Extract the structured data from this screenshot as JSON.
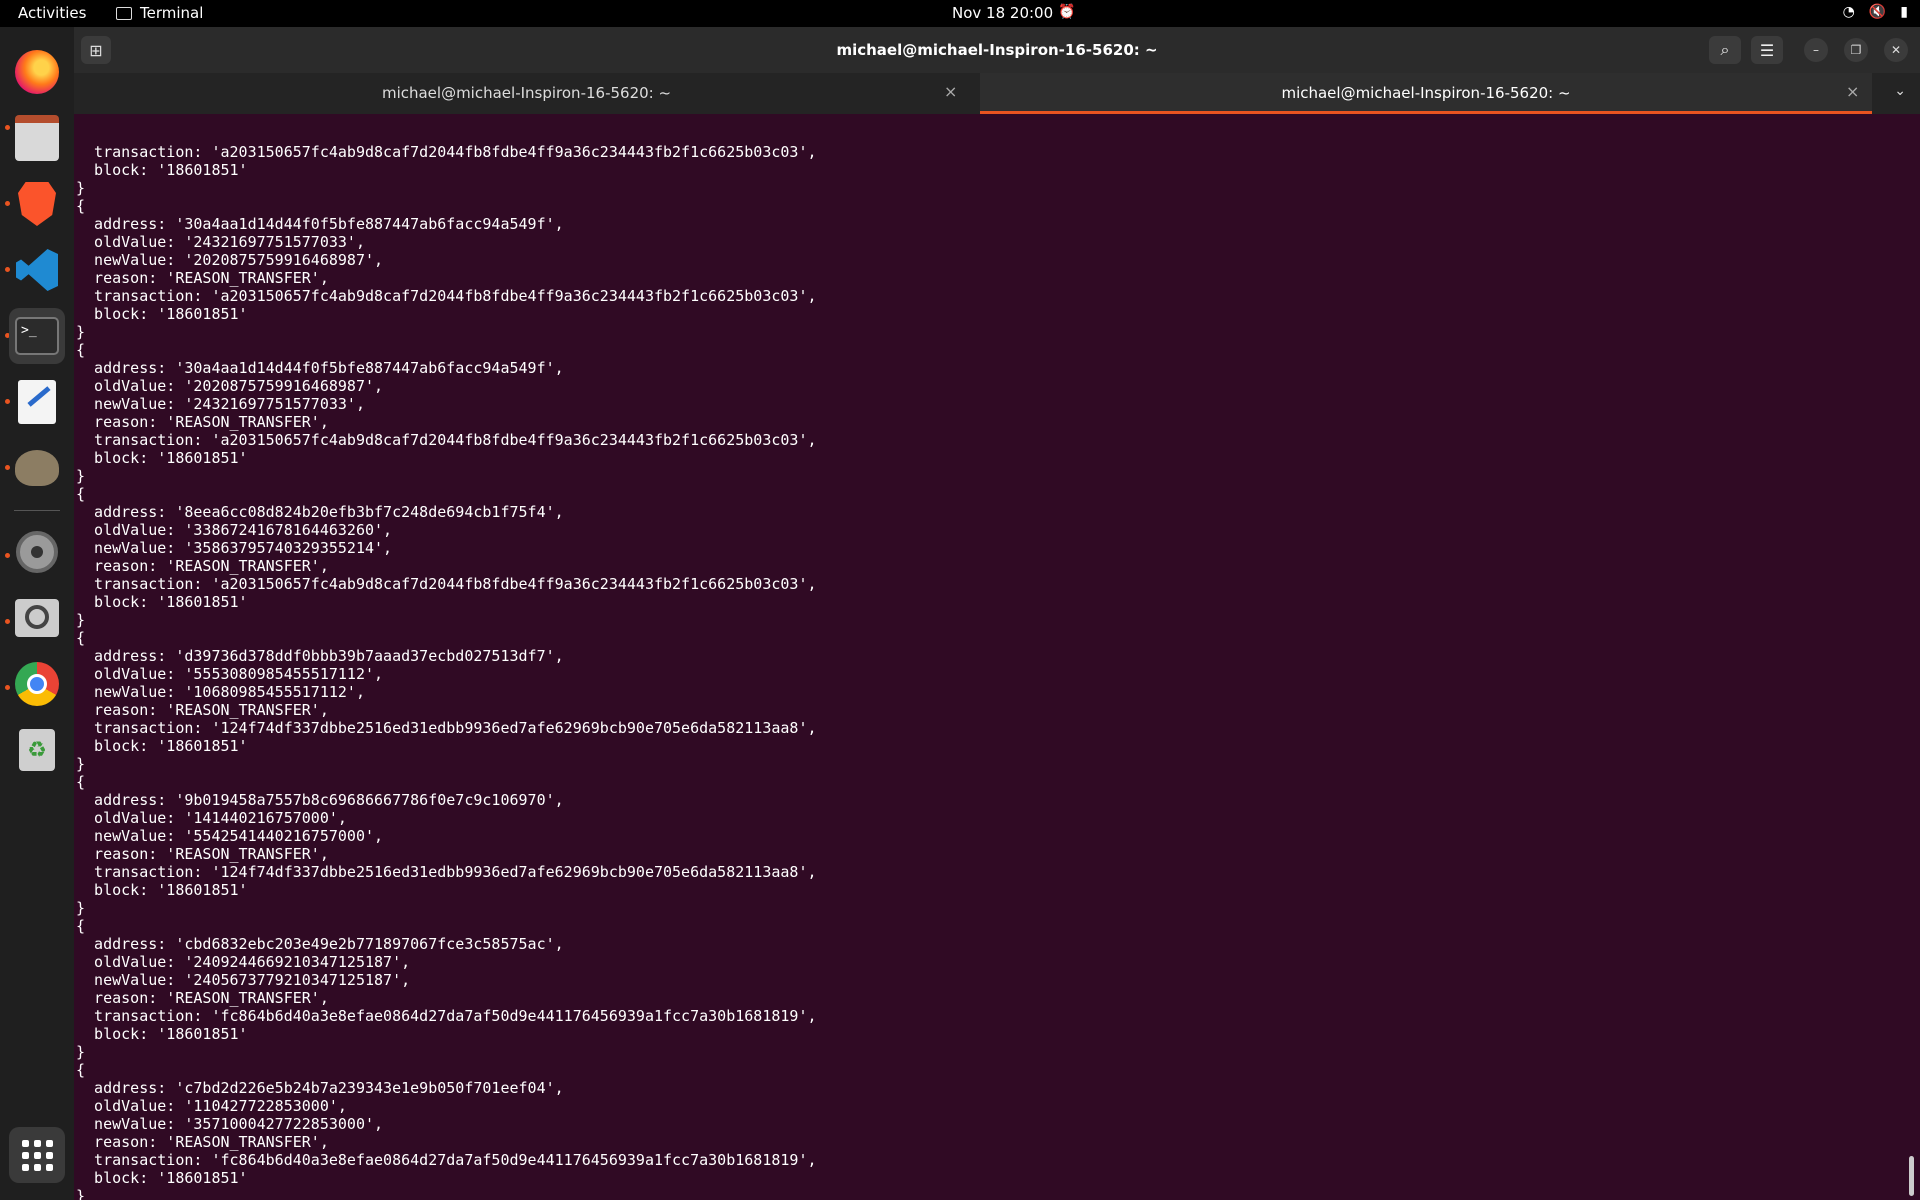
{
  "topbar": {
    "activities": "Activities",
    "app_name": "Terminal",
    "datetime": "Nov 18  20:00"
  },
  "dock": {
    "items": [
      "Firefox",
      "Files",
      "Brave",
      "Visual Studio Code",
      "Terminal",
      "Text Editor",
      "GIMP",
      "Settings",
      "Image Viewer",
      "Google Chrome",
      "Trash",
      "Show Applications"
    ]
  },
  "window": {
    "title": "michael@michael-Inspiron-16-5620: ~",
    "tabs": [
      {
        "label": "michael@michael-Inspiron-16-5620: ~",
        "active": false
      },
      {
        "label": "michael@michael-Inspiron-16-5620: ~",
        "active": true
      }
    ]
  },
  "terminal": {
    "lines": [
      "  transaction: 'a203150657fc4ab9d8caf7d2044fb8fdbe4ff9a36c234443fb2f1c6625b03c03',",
      "  block: '18601851'",
      "}",
      "{",
      "  address: '30a4aa1d14d44f0f5bfe887447ab6facc94a549f',",
      "  oldValue: '24321697751577033',",
      "  newValue: '2020875759916468987',",
      "  reason: 'REASON_TRANSFER',",
      "  transaction: 'a203150657fc4ab9d8caf7d2044fb8fdbe4ff9a36c234443fb2f1c6625b03c03',",
      "  block: '18601851'",
      "}",
      "{",
      "  address: '30a4aa1d14d44f0f5bfe887447ab6facc94a549f',",
      "  oldValue: '2020875759916468987',",
      "  newValue: '24321697751577033',",
      "  reason: 'REASON_TRANSFER',",
      "  transaction: 'a203150657fc4ab9d8caf7d2044fb8fdbe4ff9a36c234443fb2f1c6625b03c03',",
      "  block: '18601851'",
      "}",
      "{",
      "  address: '8eea6cc08d824b20efb3bf7c248de694cb1f75f4',",
      "  oldValue: '33867241678164463260',",
      "  newValue: '35863795740329355214',",
      "  reason: 'REASON_TRANSFER',",
      "  transaction: 'a203150657fc4ab9d8caf7d2044fb8fdbe4ff9a36c234443fb2f1c6625b03c03',",
      "  block: '18601851'",
      "}",
      "{",
      "  address: 'd39736d378ddf0bbb39b7aaad37ecbd027513df7',",
      "  oldValue: '5553080985455517112',",
      "  newValue: '10680985455517112',",
      "  reason: 'REASON_TRANSFER',",
      "  transaction: '124f74df337dbbe2516ed31edbb9936ed7afe62969bcb90e705e6da582113aa8',",
      "  block: '18601851'",
      "}",
      "{",
      "  address: '9b019458a7557b8c69686667786f0e7c9c106970',",
      "  oldValue: '141440216757000',",
      "  newValue: '5542541440216757000',",
      "  reason: 'REASON_TRANSFER',",
      "  transaction: '124f74df337dbbe2516ed31edbb9936ed7afe62969bcb90e705e6da582113aa8',",
      "  block: '18601851'",
      "}",
      "{",
      "  address: 'cbd6832ebc203e49e2b771897067fce3c58575ac',",
      "  oldValue: '2409244669210347125187',",
      "  newValue: '2405673779210347125187',",
      "  reason: 'REASON_TRANSFER',",
      "  transaction: 'fc864b6d40a3e8efae0864d27da7af50d9e441176456939a1fcc7a30b1681819',",
      "  block: '18601851'",
      "}",
      "{",
      "  address: 'c7bd2d226e5b24b7a239343e1e9b050f701eef04',",
      "  oldValue: '110427722853000',",
      "  newValue: '3571000427722853000',",
      "  reason: 'REASON_TRANSFER',",
      "  transaction: 'fc864b6d40a3e8efae0864d27da7af50d9e441176456939a1fcc7a30b1681819',",
      "  block: '18601851'",
      "}"
    ]
  },
  "colors": {
    "terminal_bg": "#300a24",
    "accent": "#e95420"
  }
}
